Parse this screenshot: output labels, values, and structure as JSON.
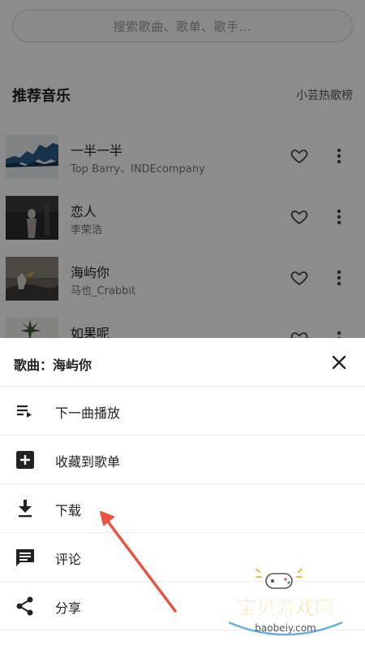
{
  "search": {
    "placeholder": "搜索歌曲、歌单、歌手..."
  },
  "section": {
    "title": "推荐音乐",
    "link": "小芸热歌榜"
  },
  "songs": [
    {
      "title": "一半一半",
      "artist": "Top Barry、INDEcompany"
    },
    {
      "title": "恋人",
      "artist": "李荣浩"
    },
    {
      "title": "海屿你",
      "artist": "马也_Crabbit"
    },
    {
      "title": "如果呢",
      "artist": ""
    }
  ],
  "sheet": {
    "title": "歌曲：海屿你",
    "items": [
      {
        "label": "下一曲播放",
        "icon": "queue-next-icon"
      },
      {
        "label": "收藏到歌单",
        "icon": "add-box-icon"
      },
      {
        "label": "下载",
        "icon": "download-icon"
      },
      {
        "label": "评论",
        "icon": "comment-icon"
      },
      {
        "label": "分享",
        "icon": "share-icon"
      }
    ]
  },
  "watermark": {
    "text": "宝贝游戏网",
    "url": "baobeiy.com"
  },
  "colors": {
    "arrow": "#e8533f",
    "watermark_gold": "#e6b422",
    "overlay": "rgba(0,0,0,0.45)"
  }
}
